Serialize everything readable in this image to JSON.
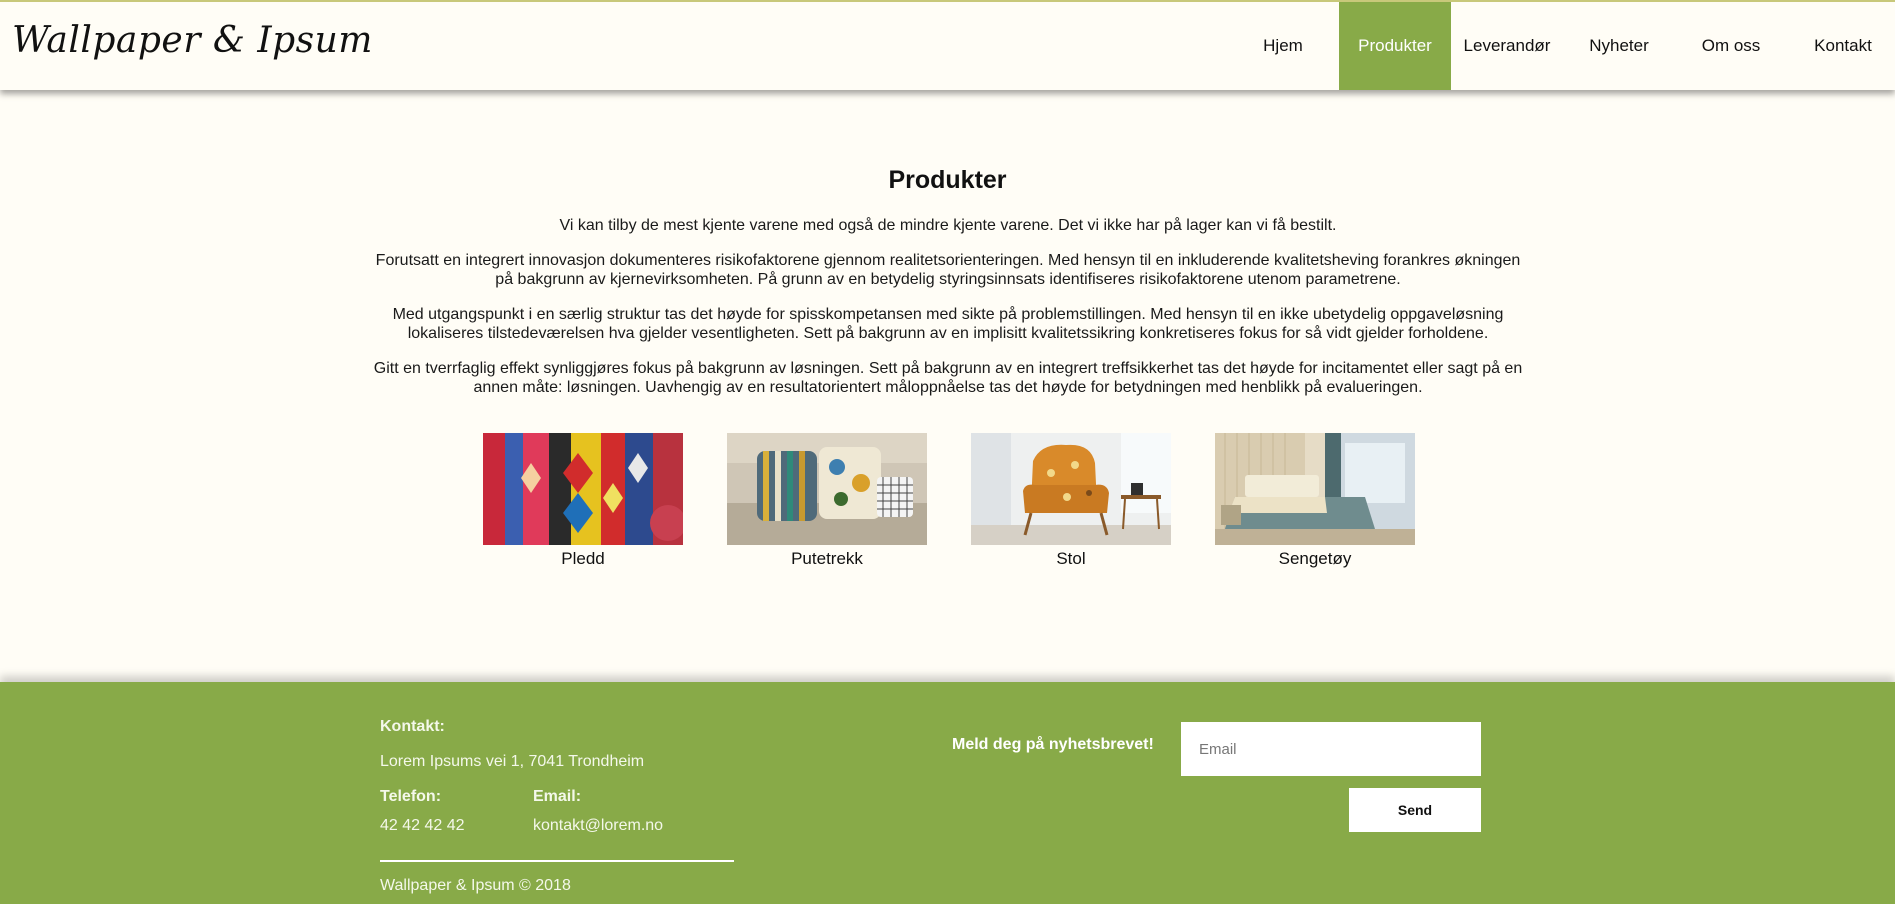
{
  "header": {
    "logo": "Wallpaper & Ipsum",
    "nav": [
      "Hjem",
      "Produkter",
      "Leverandør",
      "Nyheter",
      "Om oss",
      "Kontakt"
    ],
    "active_nav": "Produkter",
    "accent_color": "#88aa48"
  },
  "main": {
    "title": "Produkter",
    "paragraphs": [
      "Vi kan tilby de mest kjente varene med også de mindre kjente varene. Det vi ikke har på lager kan vi få bestilt.",
      "Forutsatt en integrert innovasjon dokumenteres risikofaktorene gjennom realitetsorienteringen. Med hensyn til en inkluderende kvalitetsheving forankres økningen på bakgrunn av kjernevirksomheten. På grunn av en betydelig styringsinnsats identifiseres risikofaktorene utenom parametrene.",
      "Med utgangspunkt i en særlig struktur tas det høyde for spisskompetansen med sikte på problemstillingen. Med hensyn til en ikke ubetydelig oppgaveløsning lokaliseres tilstedeværelsen hva gjelder vesentligheten. Sett på bakgrunn av en implisitt kvalitetssikring konkretiseres fokus for så vidt gjelder forholdene.",
      "Gitt en tverrfaglig effekt synliggjøres fokus på bakgrunn av løsningen. Sett på bakgrunn av en integrert treffsikkerhet tas det høyde for incitamentet eller sagt på en annen måte: løsningen. Uavhengig av en resultatorientert måloppnåelse tas det høyde for betydningen med henblikk på evalueringen."
    ],
    "products": [
      {
        "label": "Pledd",
        "image": "colorful-textiles-photo"
      },
      {
        "label": "Putetrekk",
        "image": "cushions-on-sofa-photo"
      },
      {
        "label": "Stol",
        "image": "orange-armchair-photo"
      },
      {
        "label": "Sengetøy",
        "image": "bedroom-bed-photo"
      }
    ]
  },
  "footer": {
    "contact_label": "Kontakt:",
    "address": "Lorem Ipsums vei 1, 7041 Trondheim",
    "phone_label": "Telefon:",
    "phone": "42 42 42 42",
    "email_label": "Email:",
    "email": "kontakt@lorem.no",
    "copyright": "Wallpaper & Ipsum © 2018",
    "newsletter_label": "Meld deg på nyhetsbrevet!",
    "email_placeholder": "Email",
    "send_label": "Send"
  }
}
